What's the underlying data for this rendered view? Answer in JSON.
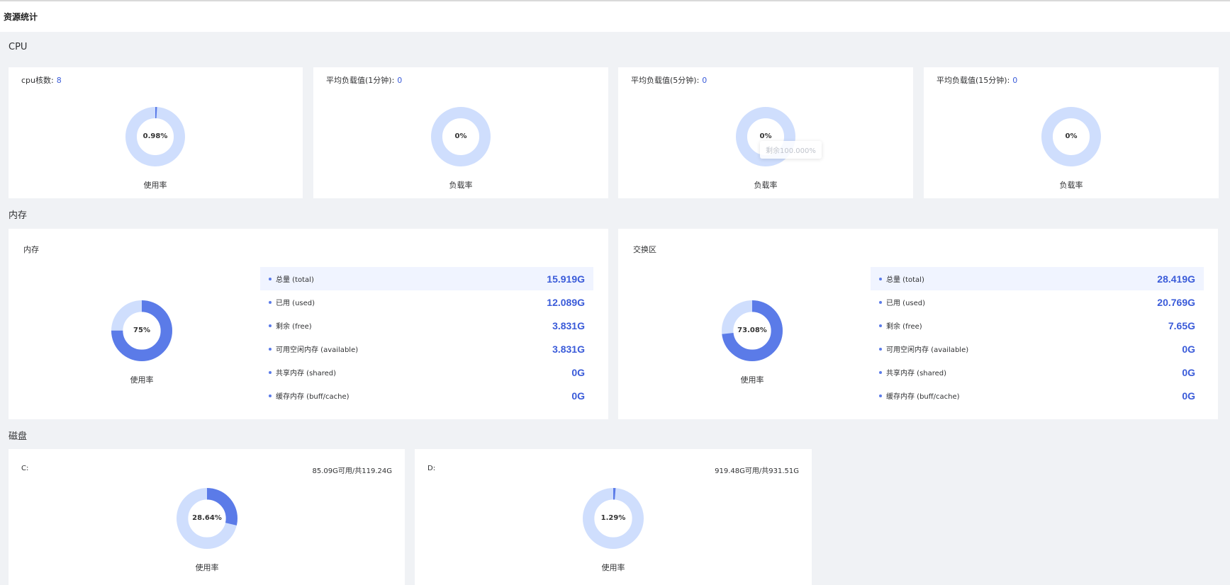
{
  "page_title": "资源统计",
  "colors": {
    "accent": "#5b7be8",
    "track": "#cfdefd",
    "value_text": "#3a5bd9"
  },
  "cpu": {
    "section_title": "CPU",
    "cards": [
      {
        "label": "cpu核数:",
        "value": "8",
        "percent_text": "0.98%",
        "percent": 0.98,
        "caption": "使用率"
      },
      {
        "label": "平均负载值(1分钟):",
        "value": "0",
        "percent_text": "0%",
        "percent": 0,
        "caption": "负载率"
      },
      {
        "label": "平均负载值(5分钟):",
        "value": "0",
        "percent_text": "0%",
        "percent": 0,
        "caption": "负载率",
        "tooltip": "剩余100.000%"
      },
      {
        "label": "平均负载值(15分钟):",
        "value": "0",
        "percent_text": "0%",
        "percent": 0,
        "caption": "负载率"
      }
    ]
  },
  "memory": {
    "section_title": "内存",
    "panels": [
      {
        "title": "内存",
        "percent_text": "75%",
        "percent": 75,
        "caption": "使用率",
        "rows": [
          {
            "label": "总量 (total)",
            "value": "15.919G"
          },
          {
            "label": "已用 (used)",
            "value": "12.089G"
          },
          {
            "label": "剩余 (free)",
            "value": "3.831G"
          },
          {
            "label": "可用空闲内存 (available)",
            "value": "3.831G"
          },
          {
            "label": "共享内存 (shared)",
            "value": "0G"
          },
          {
            "label": "缓存内存 (buff/cache)",
            "value": "0G"
          }
        ]
      },
      {
        "title": "交换区",
        "percent_text": "73.08%",
        "percent": 73.08,
        "caption": "使用率",
        "rows": [
          {
            "label": "总量 (total)",
            "value": "28.419G"
          },
          {
            "label": "已用 (used)",
            "value": "20.769G"
          },
          {
            "label": "剩余 (free)",
            "value": "7.65G"
          },
          {
            "label": "可用空闲内存 (available)",
            "value": "0G"
          },
          {
            "label": "共享内存 (shared)",
            "value": "0G"
          },
          {
            "label": "缓存内存 (buff/cache)",
            "value": "0G"
          }
        ]
      }
    ]
  },
  "disk": {
    "section_title": "磁盘",
    "cards": [
      {
        "name": "C:",
        "info": "85.09G可用/共119.24G",
        "percent_text": "28.64%",
        "percent": 28.64,
        "caption": "使用率"
      },
      {
        "name": "D:",
        "info": "919.48G可用/共931.51G",
        "percent_text": "1.29%",
        "percent": 1.29,
        "caption": "使用率"
      }
    ]
  }
}
